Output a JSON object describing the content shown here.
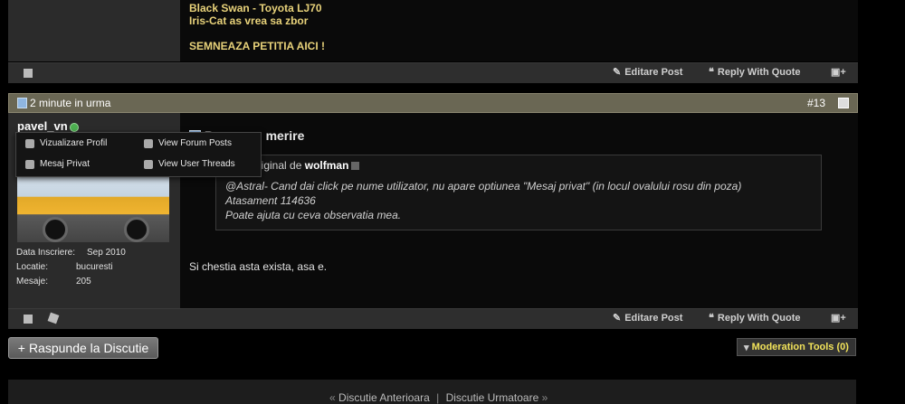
{
  "post1": {
    "signature": [
      "Black Swan - Toyota LJ70",
      "Iris-Cat as vrea sa zbor",
      "SEMNEAZA PETITIA AICI !"
    ],
    "footer": {
      "edit_label": "Editare Post",
      "reply_label": "Reply With Quote"
    }
  },
  "post2": {
    "date": "2 minute in urma",
    "number": "#13",
    "username": "pavel_vn",
    "info": [
      {
        "label": "Data Inscriere:",
        "value": "Sep 2010"
      },
      {
        "label": "Locatie:",
        "value": "bucuresti"
      },
      {
        "label": "Mesaje:",
        "value": "205"
      }
    ],
    "title": "Raspuns: merire",
    "quote": {
      "prefix": "Citat original de",
      "author": "wolfman",
      "lines": [
        "@Astral- Cand dai click pe nume utilizator, nu apare optiunea \"Mesaj privat\" (in locul ovalului rosu din poza)",
        "Atasament 114636",
        "Poate ajuta cu ceva observatia mea."
      ]
    },
    "body": "Si chestia asta exista, asa e.",
    "footer": {
      "edit_label": "Editare Post",
      "reply_label": "Reply With Quote"
    }
  },
  "user_menu": {
    "items": [
      "Vizualizare Profil",
      "View Forum Posts",
      "Mesaj Privat",
      "View User Threads"
    ]
  },
  "actions": {
    "reply_thread": "Raspunde la Discutie",
    "moderation": "Moderation Tools (0)"
  },
  "nav": {
    "prev": "Discutie Anterioara",
    "next": "Discutie Urmatoare"
  }
}
